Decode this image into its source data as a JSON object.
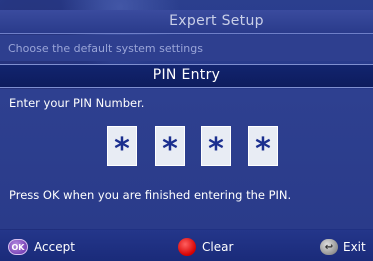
{
  "header": {
    "title": "Expert Setup",
    "subtitle": "Choose the default system settings"
  },
  "dialog": {
    "title": "PIN Entry",
    "prompt": "Enter your PIN Number.",
    "pin_digits": [
      "*",
      "*",
      "*",
      "*"
    ],
    "hint": "Press OK when you are finished entering the PIN."
  },
  "footer": {
    "accept": {
      "badge": "OK",
      "label": "Accept",
      "icon": "ok-button-icon"
    },
    "clear": {
      "label": "Clear",
      "icon": "red-button-icon"
    },
    "exit": {
      "badge": "↩",
      "label": "Exit",
      "icon": "back-button-icon"
    }
  },
  "colors": {
    "background": "#2a3b8a",
    "pin_bar": "#0d1c5e",
    "pin_box": "#e8ecf4",
    "pin_text": "#1b2f8f",
    "accept": "#7a45b8",
    "clear": "#d60000"
  }
}
